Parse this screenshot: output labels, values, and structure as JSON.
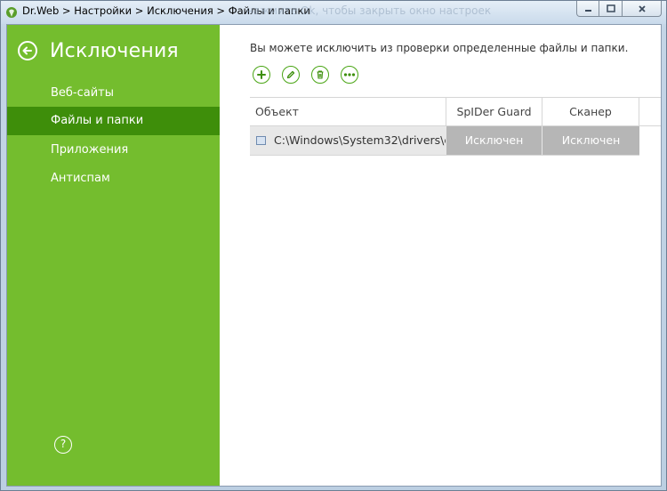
{
  "window": {
    "title": "Dr.Web > Настройки > Исключения > Файлы и папки",
    "ghost_text": "нажмите Ok, чтобы закрыть окно настроек"
  },
  "sidebar": {
    "title": "Исключения",
    "items": [
      {
        "label": "Веб-сайты",
        "active": false
      },
      {
        "label": "Файлы и папки",
        "active": true
      },
      {
        "label": "Приложения",
        "active": false
      },
      {
        "label": "Антиспам",
        "active": false
      }
    ],
    "help_label": "?"
  },
  "main": {
    "description": "Вы можете исключить из проверки определенные файлы и папки.",
    "toolbar": [
      "add-icon",
      "edit-icon",
      "delete-icon",
      "more-icon"
    ],
    "table": {
      "columns": [
        "Объект",
        "SpIDer Guard",
        "Сканер"
      ],
      "rows": [
        {
          "object": "C:\\Windows\\System32\\drivers\\e...",
          "spider_guard": "Исключен",
          "scanner": "Исключен"
        }
      ]
    }
  },
  "colors": {
    "sidebar_bg": "#74bd2e",
    "sidebar_active": "#3e8e0a",
    "accent_icon": "#4aa515",
    "excluded_cell": "#b6b6b6"
  }
}
